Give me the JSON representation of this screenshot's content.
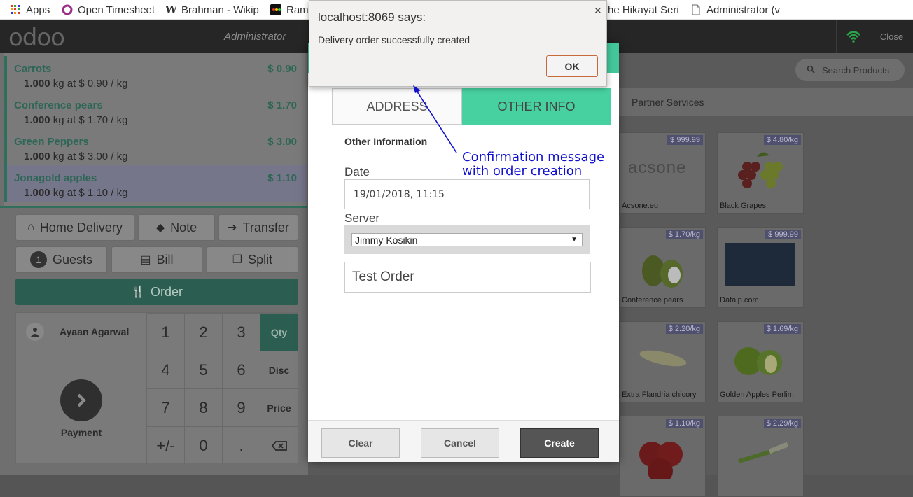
{
  "bookmarks": [
    {
      "label": "Apps",
      "icon": "apps-grid-icon"
    },
    {
      "label": "Open Timesheet",
      "icon": "timesheet-ring-icon"
    },
    {
      "label": "Brahman - Wikip",
      "icon": "wikipedia-icon"
    },
    {
      "label": "Ram",
      "icon": "site-icon"
    },
    {
      "label": "he Hikayat Seri",
      "icon": ""
    },
    {
      "label": "Administrator (v",
      "icon": "page-icon"
    }
  ],
  "header": {
    "logo": "odoo",
    "user": "Administrator",
    "close_label": "Close",
    "status_color": "#2aa34a"
  },
  "orderlines": [
    {
      "name": "Carrots",
      "price": "$ 0.90",
      "qty": "1.000",
      "detail": "kg at $ 0.90 / kg"
    },
    {
      "name": "Conference pears",
      "price": "$ 1.70",
      "qty": "1.000",
      "detail": "kg at $ 1.70 / kg"
    },
    {
      "name": "Green Peppers",
      "price": "$ 3.00",
      "qty": "1.000",
      "detail": "kg at $ 3.00 / kg"
    },
    {
      "name": "Jonagold apples",
      "price": "$ 1.10",
      "qty": "1.000",
      "detail": "kg at $ 1.10 / kg"
    }
  ],
  "controls": {
    "home_delivery": "Home Delivery",
    "note": "Note",
    "transfer": "Transfer",
    "guests_count": "1",
    "guests": "Guests",
    "bill": "Bill",
    "split": "Split",
    "order": "Order"
  },
  "customer": "Ayaan Agarwal",
  "payment": "Payment",
  "numpad": {
    "keys": [
      "1",
      "2",
      "3",
      "4",
      "5",
      "6",
      "7",
      "8",
      "9",
      "+/-",
      "0",
      "."
    ],
    "modes": [
      "Qty",
      "Disc",
      "Price"
    ]
  },
  "products": {
    "search_placeholder": "Search Products",
    "category": "Partner Services",
    "items": [
      {
        "name": "Acsone.eu",
        "price": "$ 999.99",
        "logo_text": "acsone"
      },
      {
        "name": "Black Grapes",
        "price": "$ 4.80/kg"
      },
      {
        "name": "Conference pears",
        "price": "$ 1.70/kg"
      },
      {
        "name": "Datalp.com",
        "price": "$ 999.99"
      },
      {
        "name": "Extra Flandria chicory",
        "price": "$ 2.20/kg"
      },
      {
        "name": "Golden Apples Perlim",
        "price": "$ 1.69/kg"
      },
      {
        "name": "",
        "price": "$ 1.10/kg"
      },
      {
        "name": "",
        "price": "$ 2.29/kg"
      }
    ]
  },
  "modal": {
    "tabs": [
      "ADDRESS",
      "OTHER INFO"
    ],
    "section_title": "Other Information",
    "date_label": "Date",
    "date_value": "19/01/2018, 11:15",
    "server_label": "Server",
    "server_value": "Jimmy Kosikin",
    "note_value": "Test Order",
    "buttons": {
      "clear": "Clear",
      "cancel": "Cancel",
      "create": "Create"
    }
  },
  "alert": {
    "title": "localhost:8069 says:",
    "message": "Delivery order successfully created",
    "ok": "OK"
  },
  "annotation": {
    "line1": "Confirmation message",
    "line2": "with order creation",
    "color": "#1010d0"
  }
}
